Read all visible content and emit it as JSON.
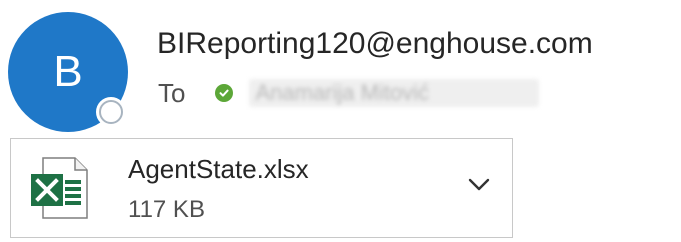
{
  "sender": {
    "avatar_initial": "B",
    "email": "BIReporting120@enghouse.com",
    "presence_icon": "presence-unknown-icon"
  },
  "recipients": {
    "to_label": "To",
    "status_icon": "verified-check-icon",
    "status_color": "#5ca738",
    "name": "Anamarija Mitović"
  },
  "attachment": {
    "file_name": "AgentState.xlsx",
    "file_size": "117 KB",
    "file_icon": "excel-file-icon",
    "expand_icon": "chevron-down-icon"
  },
  "colors": {
    "avatar_bg": "#1f78c8",
    "excel_green": "#1e7145"
  }
}
